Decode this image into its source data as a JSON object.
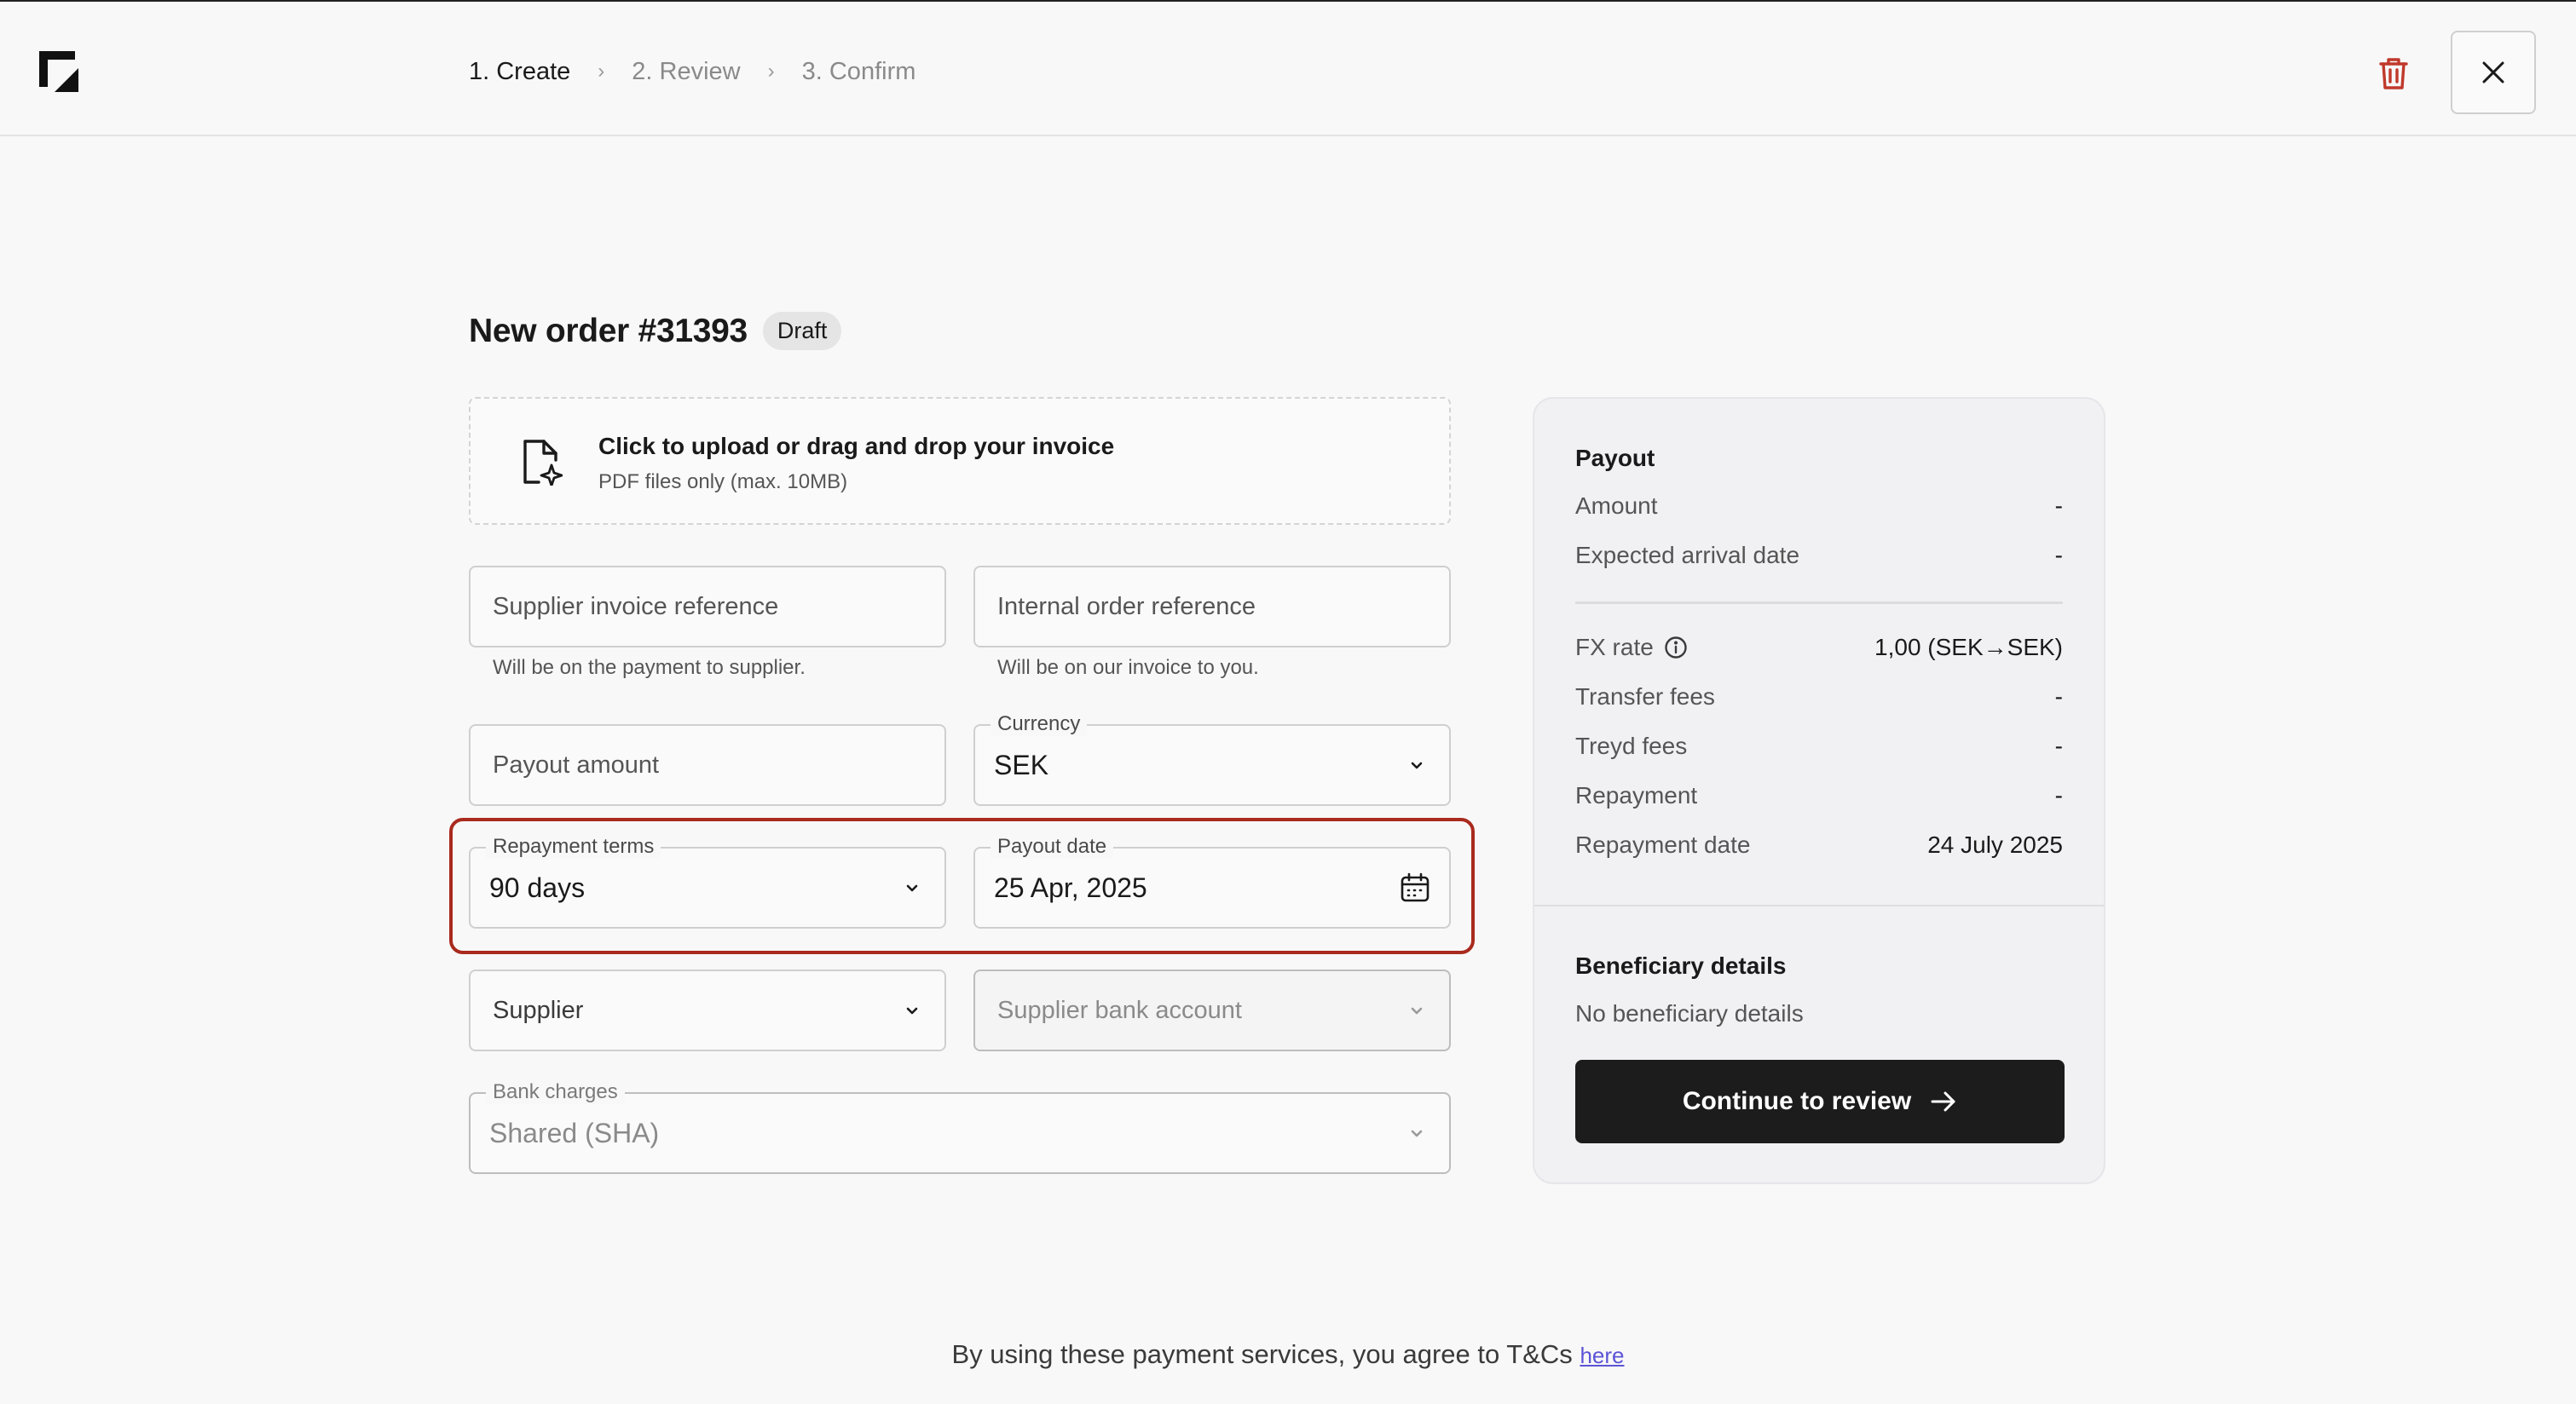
{
  "header": {
    "steps": [
      "1. Create",
      "2. Review",
      "3. Confirm"
    ],
    "active_step": 0,
    "icons": {
      "logo": "app-logo",
      "trash": "trash-icon",
      "close": "close-icon"
    },
    "colors": {
      "trash": "#c0392b"
    }
  },
  "order": {
    "title": "New order #31393",
    "status": "Draft"
  },
  "upload": {
    "title": "Click to upload or drag and drop your invoice",
    "hint": "PDF files only (max. 10MB)",
    "icon": "file-sparkle-icon"
  },
  "form": {
    "supplier_invoice_ref": {
      "placeholder": "Supplier invoice reference",
      "help": "Will be on the payment to supplier."
    },
    "internal_order_ref": {
      "placeholder": "Internal order reference",
      "help": "Will be on our invoice to you."
    },
    "payout_amount": {
      "placeholder": "Payout amount"
    },
    "currency": {
      "label": "Currency",
      "value": "SEK"
    },
    "repayment_terms": {
      "label": "Repayment terms",
      "value": "90 days"
    },
    "payout_date": {
      "label": "Payout date",
      "value": "25 Apr, 2025"
    },
    "supplier": {
      "placeholder": "Supplier"
    },
    "supplier_bank_account": {
      "placeholder": "Supplier bank account"
    },
    "bank_charges": {
      "label": "Bank charges",
      "value": "Shared (SHA)"
    },
    "highlight_color": "#a92a1e"
  },
  "summary": {
    "payout_heading": "Payout",
    "amount_label": "Amount",
    "amount_value": "-",
    "arrival_label": "Expected arrival date",
    "arrival_value": "-",
    "fx_label": "FX rate",
    "fx_value": "1,00 (SEK→SEK)",
    "transfer_label": "Transfer fees",
    "transfer_value": "-",
    "treyd_label": "Treyd fees",
    "treyd_value": "-",
    "repayment_label": "Repayment",
    "repayment_value": "-",
    "repayment_date_label": "Repayment date",
    "repayment_date_value": "24 July 2025",
    "beneficiary_heading": "Beneficiary details",
    "beneficiary_text": "No beneficiary details",
    "cta_label": "Continue to review"
  },
  "footer": {
    "text": "By using these payment services, you agree to T&Cs",
    "link": "here"
  }
}
